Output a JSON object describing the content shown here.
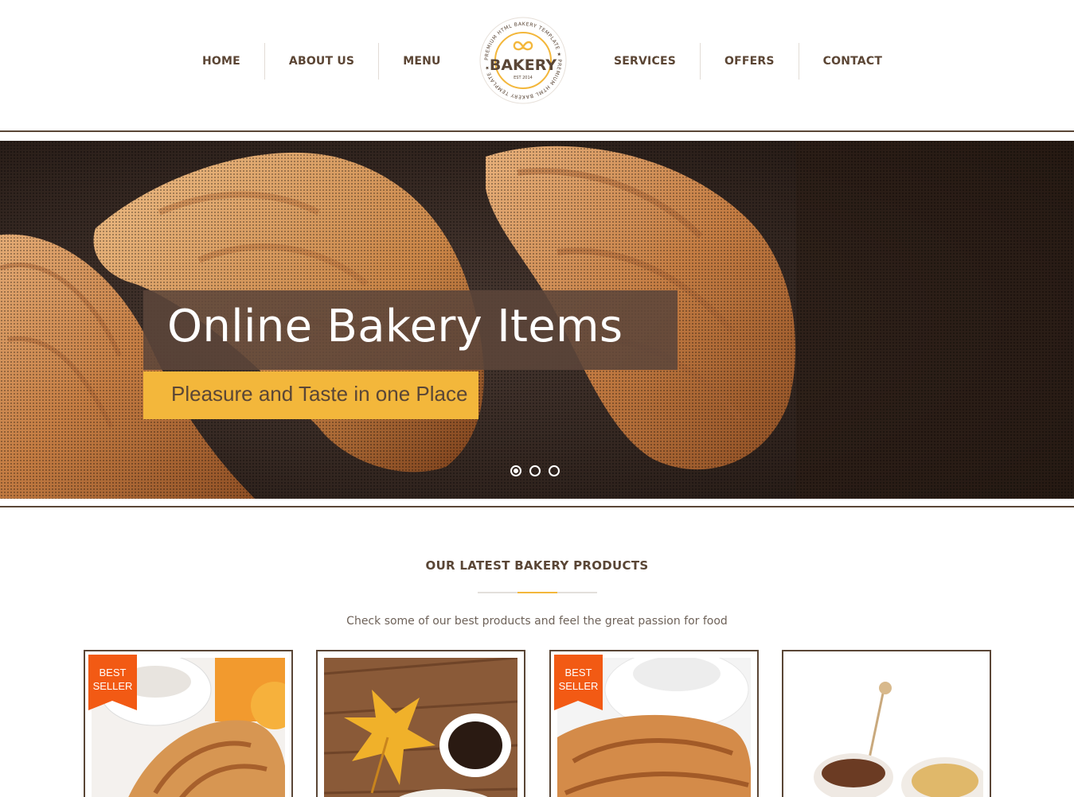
{
  "nav": {
    "left": [
      "HOME",
      "ABOUT US",
      "MENU"
    ],
    "right": [
      "SERVICES",
      "OFFERS",
      "CONTACT"
    ]
  },
  "logo": {
    "name": "BAKERY",
    "est": "EST 2014",
    "ring_text": "PREMIUM HTML BAKERY TEMPLATE ★ PREMIUM HTML BAKERY TEMPLATE ★"
  },
  "hero": {
    "title": "Online Bakery Items",
    "subtitle": "Pleasure and Taste in one Place",
    "slides": 3,
    "active_slide": 1
  },
  "section": {
    "title": "OUR LATEST BAKERY PRODUCTS",
    "subtitle": "Check some of our best products and feel the great passion for food"
  },
  "products": [
    {
      "badge_line1": "BEST",
      "badge_line2": "SELLER",
      "image": "croissant-coffee-orange-juice"
    },
    {
      "badge_line1": "",
      "badge_line2": "",
      "image": "autumn-leaf-coffee"
    },
    {
      "badge_line1": "BEST",
      "badge_line2": "SELLER",
      "image": "croissant-coffee-cup"
    },
    {
      "badge_line1": "",
      "badge_line2": "",
      "image": "honey-dipper-coffee"
    }
  ],
  "colors": {
    "brand_brown": "#5a4636",
    "accent_yellow": "#f3b73b",
    "badge_orange": "#f25a14"
  }
}
